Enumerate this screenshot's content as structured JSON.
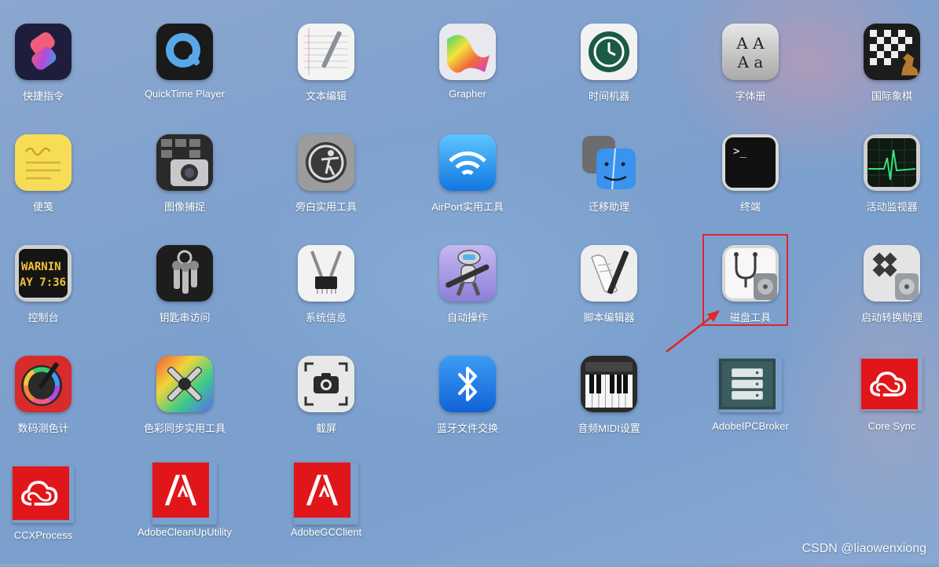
{
  "apps": [
    {
      "label": "快捷指令",
      "icon": "shortcuts-icon"
    },
    {
      "label": "QuickTime Player",
      "icon": "quicktime-icon"
    },
    {
      "label": "文本编辑",
      "icon": "textedit-icon"
    },
    {
      "label": "Grapher",
      "icon": "grapher-icon"
    },
    {
      "label": "时间机器",
      "icon": "time-machine-icon"
    },
    {
      "label": "字体册",
      "icon": "font-book-icon"
    },
    {
      "label": "国际象棋",
      "icon": "chess-icon"
    },
    {
      "label": "便笺",
      "icon": "stickies-icon"
    },
    {
      "label": "图像捕捉",
      "icon": "image-capture-icon"
    },
    {
      "label": "旁白实用工具",
      "icon": "voiceover-utility-icon"
    },
    {
      "label": "AirPort实用工具",
      "icon": "airport-utility-icon"
    },
    {
      "label": "迁移助理",
      "icon": "migration-assistant-icon"
    },
    {
      "label": "终端",
      "icon": "terminal-icon"
    },
    {
      "label": "活动监视器",
      "icon": "activity-monitor-icon"
    },
    {
      "label": "控制台",
      "icon": "console-icon"
    },
    {
      "label": "钥匙串访问",
      "icon": "keychain-access-icon"
    },
    {
      "label": "系统信息",
      "icon": "system-information-icon"
    },
    {
      "label": "自动操作",
      "icon": "automator-icon"
    },
    {
      "label": "脚本编辑器",
      "icon": "script-editor-icon"
    },
    {
      "label": "磁盘工具",
      "icon": "disk-utility-icon"
    },
    {
      "label": "启动转换助理",
      "icon": "boot-camp-icon"
    },
    {
      "label": "数码测色计",
      "icon": "digital-color-meter-icon"
    },
    {
      "label": "色彩同步实用工具",
      "icon": "colorsync-utility-icon"
    },
    {
      "label": "截屏",
      "icon": "screenshot-icon"
    },
    {
      "label": "蓝牙文件交换",
      "icon": "bluetooth-file-exchange-icon"
    },
    {
      "label": "音频MIDI设置",
      "icon": "audio-midi-setup-icon"
    },
    {
      "label": "AdobeIPCBroker",
      "icon": "adobe-ipc-broker-icon"
    },
    {
      "label": "Core Sync",
      "icon": "creative-cloud-icon"
    },
    {
      "label": "CCXProcess",
      "icon": "creative-cloud-icon"
    },
    {
      "label": "AdobeCleanUpUtility",
      "icon": "adobe-icon"
    },
    {
      "label": "AdobeGCClient",
      "icon": "adobe-icon"
    }
  ],
  "console_icon_text": {
    "line1": "WARNIN",
    "line2": "AY 7:36"
  },
  "font_book_icon_text": {
    "line1": "A A",
    "line2": "A a"
  },
  "terminal_icon_text": ">_",
  "highlighted_app": "磁盘工具",
  "watermark": "CSDN @liaowenxiong",
  "colors": {
    "highlight": "#e02528",
    "adobe_red": "#e0161b",
    "label": "#ffffff"
  }
}
